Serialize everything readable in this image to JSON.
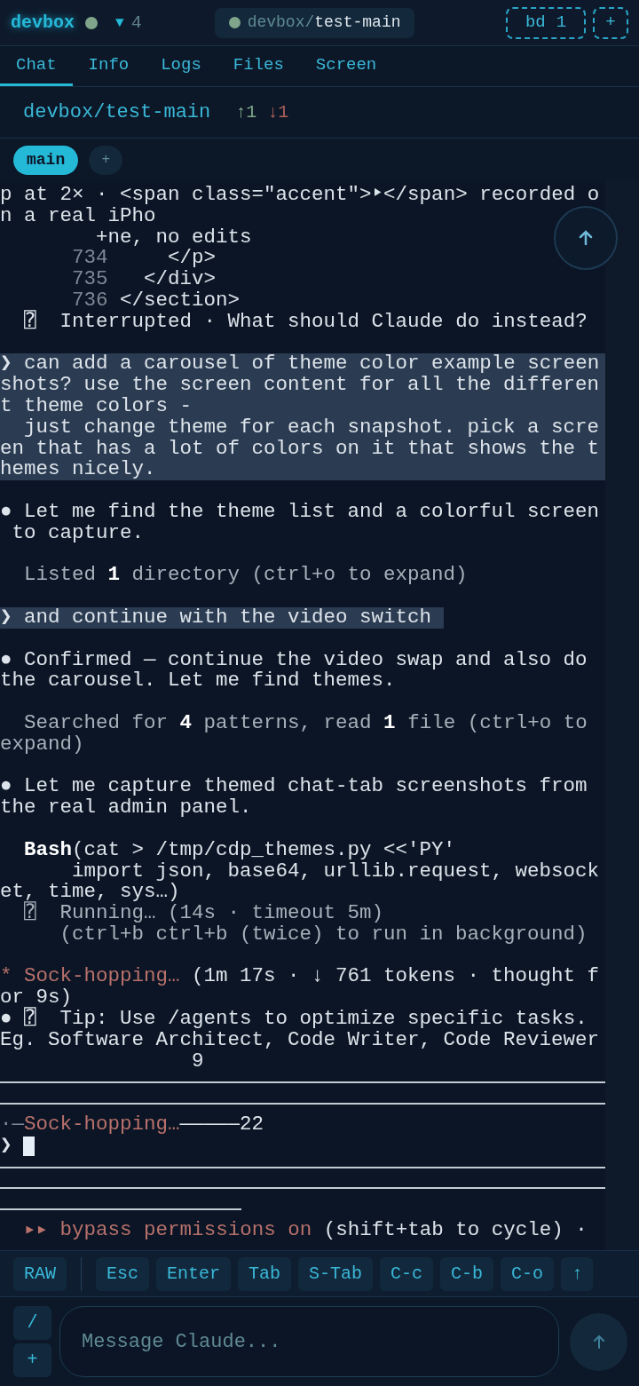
{
  "header": {
    "app_name": "devbox",
    "session_caret": "▼",
    "session_count": "4",
    "session": {
      "prefix": "devbox/",
      "name": "test-main"
    },
    "badges": [
      {
        "label": "bd",
        "count": "1"
      },
      {
        "label": "+"
      }
    ]
  },
  "tabs": [
    {
      "label": "Chat",
      "selected": true
    },
    {
      "label": "Info",
      "selected": false
    },
    {
      "label": "Logs",
      "selected": false
    },
    {
      "label": "Files",
      "selected": false
    },
    {
      "label": "Screen",
      "selected": false
    }
  ],
  "repo": {
    "path": "devbox/test-main",
    "ahead": "↑1",
    "behind": "↓1"
  },
  "branches": [
    {
      "label": "main",
      "selected": true
    }
  ],
  "add_branch": "+",
  "terminal": {
    "lines": [
      {
        "kind": "text",
        "segments": [
          {
            "text": "p at 2× · <span class=\"accent\">‣</span> recorded o",
            "kind": "plain"
          }
        ]
      },
      {
        "kind": "text",
        "segments": [
          {
            "text": "n a real iPho",
            "kind": "plain"
          }
        ]
      },
      {
        "kind": "text",
        "segments": [
          {
            "text": "        +ne, no edits",
            "kind": "plain"
          }
        ]
      },
      {
        "kind": "code",
        "number": "734",
        "code": "     </p>"
      },
      {
        "kind": "code",
        "number": "735",
        "code": "   </div>"
      },
      {
        "kind": "code",
        "number": "736",
        "code": " </section>"
      },
      {
        "kind": "text",
        "segments": [
          {
            "text": "  ⍰  Interrupted · What should Claude do instead?",
            "kind": "plain"
          }
        ]
      },
      {
        "kind": "blank"
      },
      {
        "kind": "user_block",
        "segments": [
          {
            "text": "❯ can add a carousel of theme color example screen",
            "kind": "plain"
          }
        ]
      },
      {
        "kind": "user_block",
        "segments": [
          {
            "text": "shots? use the screen content for all the differen",
            "kind": "plain"
          }
        ]
      },
      {
        "kind": "user_block",
        "segments": [
          {
            "text": "t theme colors -",
            "kind": "plain"
          }
        ]
      },
      {
        "kind": "user_block",
        "segments": [
          {
            "text": "  just change theme for each snapshot. pick a scre",
            "kind": "plain"
          }
        ]
      },
      {
        "kind": "user_block",
        "segments": [
          {
            "text": "en that has a lot of colors on it that shows the t",
            "kind": "plain"
          }
        ]
      },
      {
        "kind": "user_block",
        "segments": [
          {
            "text": "hemes nicely.",
            "kind": "plain"
          }
        ]
      },
      {
        "kind": "blank"
      },
      {
        "kind": "text",
        "segments": [
          {
            "text": "● Let me find the theme list and a colorful screen",
            "kind": "plain"
          }
        ]
      },
      {
        "kind": "text",
        "segments": [
          {
            "text": " to capture.",
            "kind": "plain"
          }
        ]
      },
      {
        "kind": "blank"
      },
      {
        "kind": "text",
        "segments": [
          {
            "text": "  Listed **1** directory (ctrl+o to expand)",
            "kind": "muted"
          }
        ]
      },
      {
        "kind": "blank"
      },
      {
        "kind": "user_inline",
        "segments": [
          {
            "text": "❯ and continue with the video switch ",
            "kind": "plain"
          }
        ]
      },
      {
        "kind": "blank"
      },
      {
        "kind": "text",
        "segments": [
          {
            "text": "● Confirmed — continue the video swap and also do",
            "kind": "plain"
          }
        ]
      },
      {
        "kind": "text",
        "segments": [
          {
            "text": "the carousel. Let me find themes.",
            "kind": "plain"
          }
        ]
      },
      {
        "kind": "blank"
      },
      {
        "kind": "text",
        "segments": [
          {
            "text": "  Searched for **4** patterns, read **1** file (ctrl+o to",
            "kind": "muted"
          }
        ]
      },
      {
        "kind": "text",
        "segments": [
          {
            "text": "expand)",
            "kind": "muted"
          }
        ]
      },
      {
        "kind": "blank"
      },
      {
        "kind": "text",
        "segments": [
          {
            "text": "● Let me capture themed chat-tab screenshots from",
            "kind": "plain"
          }
        ]
      },
      {
        "kind": "text",
        "segments": [
          {
            "text": "the real admin panel.",
            "kind": "plain"
          }
        ]
      },
      {
        "kind": "blank"
      },
      {
        "kind": "text",
        "segments": [
          {
            "text": "  **Bash**(cat > /tmp/cdp_themes.py <<'PY'",
            "kind": "plain"
          }
        ]
      },
      {
        "kind": "text",
        "segments": [
          {
            "text": "      import json, base64, urllib.request, websock",
            "kind": "plain"
          }
        ]
      },
      {
        "kind": "text",
        "segments": [
          {
            "text": "et, time, sys…)",
            "kind": "plain"
          }
        ]
      },
      {
        "kind": "text",
        "segments": [
          {
            "text": "  ⍰  Running… (14s · timeout 5m)",
            "kind": "muted"
          }
        ]
      },
      {
        "kind": "text",
        "segments": [
          {
            "text": "     (ctrl+b ctrl+b (twice) to run in background)",
            "kind": "muted"
          }
        ]
      },
      {
        "kind": "blank"
      },
      {
        "kind": "text",
        "segments": [
          {
            "text": "* Sock-hopping…",
            "kind": "warn"
          },
          {
            "text": " (1m 17s · ↓ 761 tokens · thought f",
            "kind": "plain"
          }
        ]
      },
      {
        "kind": "text",
        "segments": [
          {
            "text": "or 9s)",
            "kind": "plain"
          }
        ]
      },
      {
        "kind": "text",
        "segments": [
          {
            "text": "● ⍰  Tip: Use /agents to optimize specific tasks.",
            "kind": "plain"
          }
        ]
      },
      {
        "kind": "text",
        "segments": [
          {
            "text": "Eg. Software Architect, Code Writer, Code Reviewer",
            "kind": "plain"
          }
        ]
      },
      {
        "kind": "text",
        "segments": [
          {
            "text": "                9",
            "kind": "plain"
          }
        ]
      },
      {
        "kind": "rule"
      },
      {
        "kind": "rule"
      },
      {
        "kind": "text",
        "segments": [
          {
            "text": "·—",
            "kind": "dim"
          },
          {
            "text": "Sock-hopping…",
            "kind": "warn"
          },
          {
            "text": "—————",
            "kind": "plain"
          },
          {
            "text": "22",
            "kind": "plain"
          }
        ]
      },
      {
        "kind": "cursor",
        "prompt": "❯"
      },
      {
        "kind": "rule"
      },
      {
        "kind": "rule"
      },
      {
        "kind": "rule_short"
      },
      {
        "kind": "text",
        "segments": [
          {
            "text": "  ▸▸ bypass permissions on",
            "kind": "warn"
          },
          {
            "text": " (shift+tab to cycle) ·",
            "kind": "plain"
          }
        ]
      }
    ]
  },
  "keys": {
    "mode": "RAW",
    "items": [
      "Esc",
      "Enter",
      "Tab",
      "S-Tab",
      "C-c",
      "C-b",
      "C-o",
      "↑"
    ]
  },
  "composer": {
    "side_buttons": [
      "/",
      "+"
    ],
    "placeholder": "Message Claude..."
  }
}
